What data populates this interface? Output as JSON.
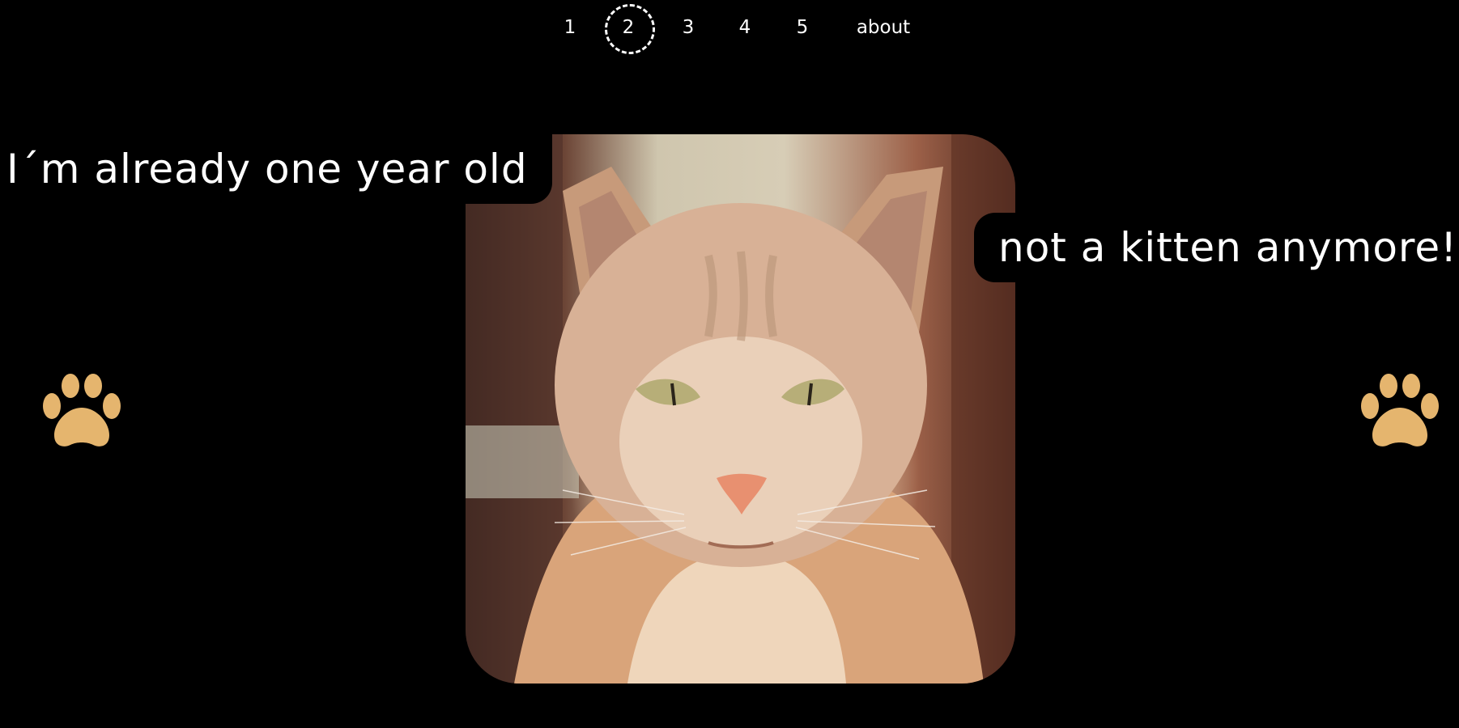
{
  "nav": {
    "items": [
      {
        "label": "1",
        "active": false
      },
      {
        "label": "2",
        "active": true
      },
      {
        "label": "3",
        "active": false
      },
      {
        "label": "4",
        "active": false
      },
      {
        "label": "5",
        "active": false
      },
      {
        "label": "about",
        "active": false
      }
    ]
  },
  "captions": {
    "left": "I´m already one year old",
    "right": "not a kitten anymore!"
  },
  "icons": {
    "left": "paw-icon",
    "right": "paw-icon",
    "paw_color": "#e5b56e"
  },
  "photo": {
    "subject": "cat-photo"
  }
}
